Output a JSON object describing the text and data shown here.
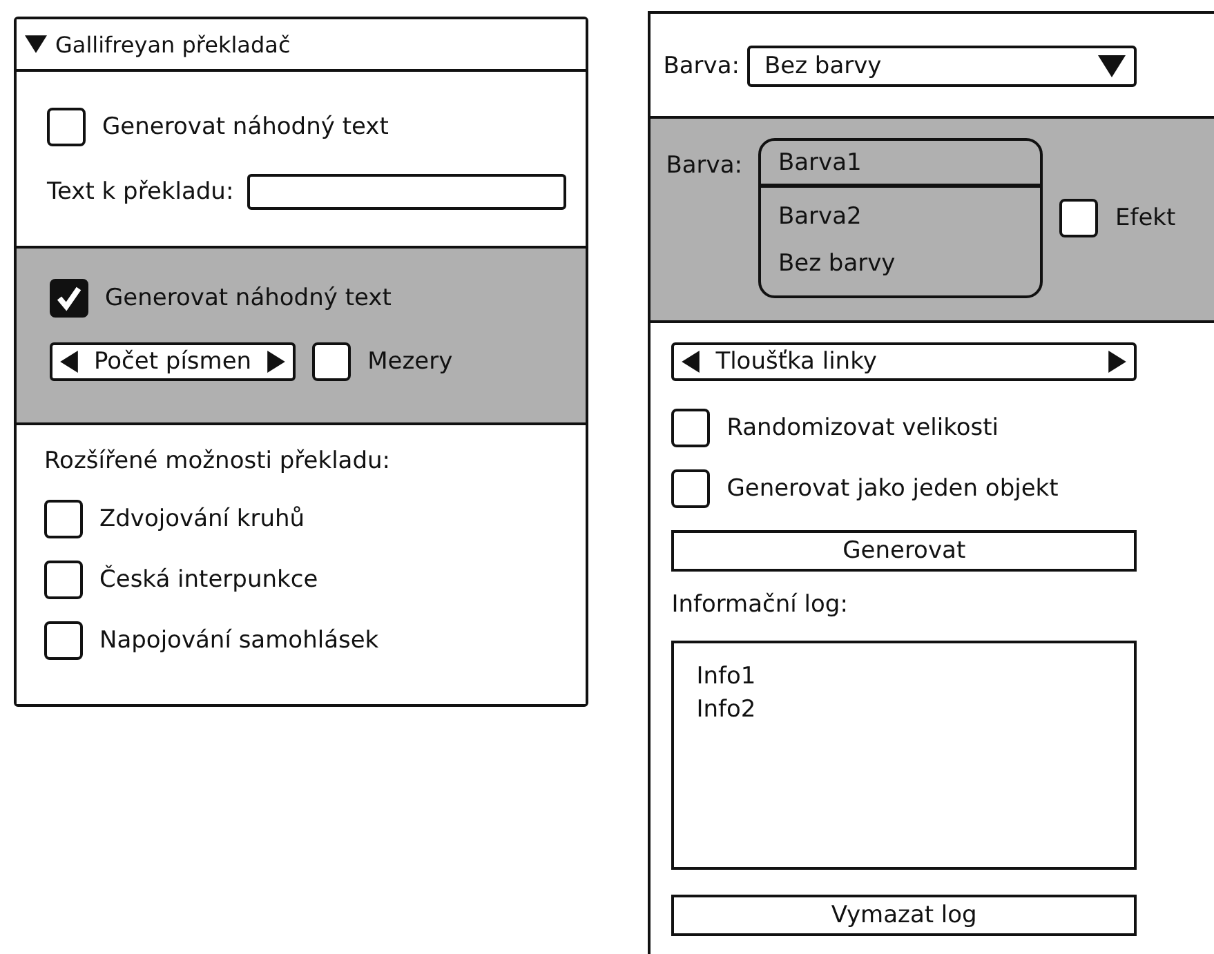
{
  "left_panel": {
    "title": "Gallifreyan překladač",
    "sections": [
      {
        "highlighted": false,
        "items": [
          {
            "kind": "checkbox",
            "label": "Generovat náhodný text",
            "checked": false
          },
          {
            "kind": "text_field",
            "label": "Text k překladu:"
          }
        ]
      },
      {
        "highlighted": true,
        "items": [
          {
            "kind": "checkbox",
            "label": "Generovat náhodný text",
            "checked": true
          },
          {
            "kind": "row",
            "items": [
              {
                "kind": "spinner",
                "label": "Počet písmen"
              },
              {
                "kind": "checkbox",
                "label": "Mezery",
                "checked": false
              }
            ]
          }
        ]
      },
      {
        "highlighted": false,
        "items": [
          {
            "kind": "label",
            "text": "Rozšířené možnosti překladu:"
          },
          {
            "kind": "checkbox",
            "label": "Zdvojování kruhů",
            "checked": false
          },
          {
            "kind": "checkbox",
            "label": "Česká interpunkce",
            "checked": false
          },
          {
            "kind": "checkbox",
            "label": "Napojování samohlásek",
            "checked": false
          }
        ]
      }
    ]
  },
  "right_panel": {
    "sections": [
      {
        "highlighted": false,
        "items": [
          {
            "kind": "dropdown",
            "label": "Barva:",
            "value": "Bez barvy"
          }
        ]
      },
      {
        "highlighted": true,
        "items": [
          {
            "kind": "row",
            "items": [
              {
                "kind": "listbox",
                "label": "Barva:",
                "options": [
                  {
                    "text": "Barva1",
                    "selected": true
                  },
                  {
                    "text": "Barva2",
                    "selected": false
                  },
                  {
                    "text": "Bez barvy",
                    "selected": false
                  }
                ]
              },
              {
                "kind": "checkbox",
                "label": "Efekt",
                "checked": false
              }
            ]
          }
        ]
      },
      {
        "highlighted": false,
        "items": [
          {
            "kind": "spinner",
            "label": "Tloušťka linky"
          },
          {
            "kind": "checkbox",
            "label": "Randomizovat velikosti",
            "checked": false
          },
          {
            "kind": "checkbox",
            "label": "Generovat jako jeden objekt",
            "checked": false
          },
          {
            "kind": "button",
            "label": "Generovat"
          },
          {
            "kind": "label",
            "text": "Informační log:"
          },
          {
            "kind": "log",
            "lines": [
              "Info1",
              "Info2"
            ]
          },
          {
            "kind": "button",
            "label": "Vymazat log"
          }
        ]
      }
    ]
  }
}
